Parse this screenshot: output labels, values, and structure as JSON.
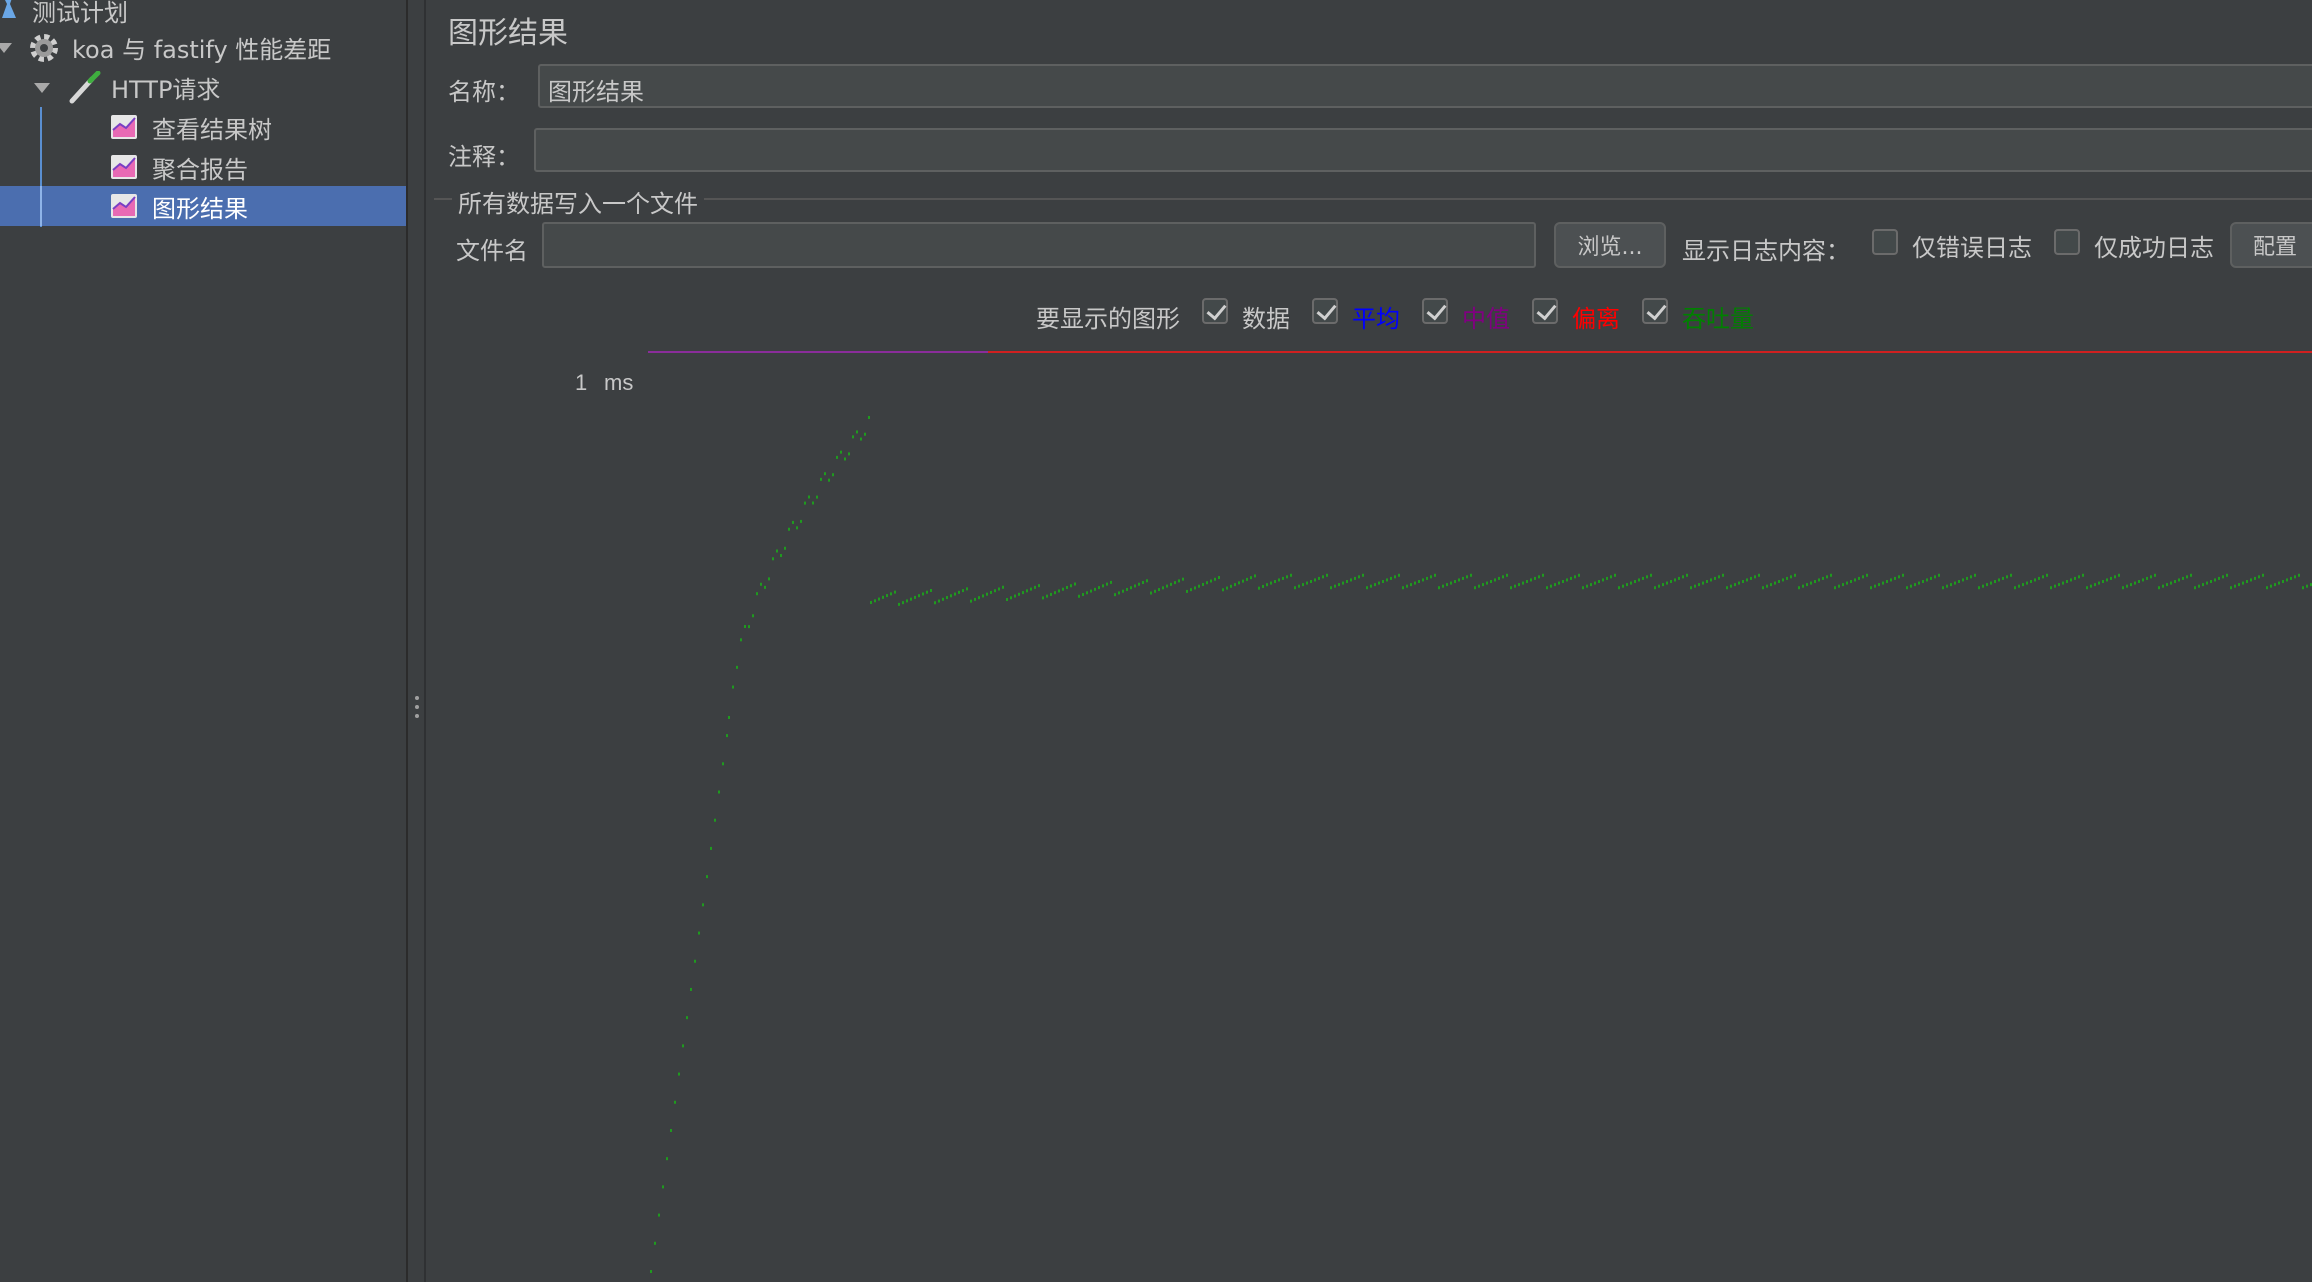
{
  "tree": {
    "items": [
      {
        "label": "测试计划"
      },
      {
        "label": "koa 与 fastify 性能差距"
      },
      {
        "label": "HTTP请求"
      },
      {
        "label": "查看结果树"
      },
      {
        "label": "聚合报告"
      },
      {
        "label": "图形结果"
      }
    ]
  },
  "panel": {
    "title": "图形结果",
    "name_label": "名称：",
    "name_value": "图形结果",
    "comment_label": "注释：",
    "comment_value": "",
    "file_section": "所有数据写入一个文件",
    "filename_label": "文件名",
    "filename_value": "",
    "browse_button": "浏览...",
    "log_label": "显示日志内容：",
    "errors_only": "仅错误日志",
    "success_only": "仅成功日志",
    "configure_button": "配置",
    "graphs_label": "要显示的图形",
    "toggles": [
      {
        "label": "数据",
        "checked": true,
        "color": "#c8c8c8"
      },
      {
        "label": "平均",
        "checked": true,
        "color": "#0000ff"
      },
      {
        "label": "中值",
        "checked": true,
        "color": "#800080"
      },
      {
        "label": "偏离",
        "checked": true,
        "color": "#ff0000"
      },
      {
        "label": "吞吐量",
        "checked": true,
        "color": "#008000"
      }
    ]
  },
  "graph": {
    "y_value_label": "1",
    "y_unit": "ms"
  },
  "colors": {
    "selected_bg": "#4b6eaf",
    "throughput": "#1f9a1f",
    "deviation": "#d02020",
    "median": "#8a2d9a"
  }
}
